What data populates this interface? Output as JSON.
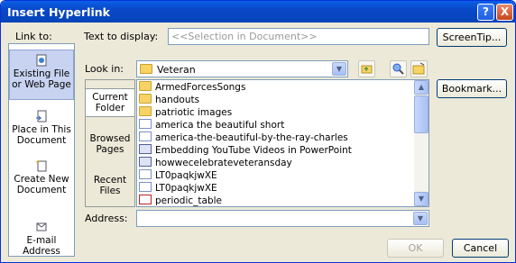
{
  "window": {
    "title": "Insert Hyperlink",
    "help": "?",
    "close": "X"
  },
  "link_to": {
    "label": "Link to:",
    "items": [
      {
        "label": "Existing File or Web Page"
      },
      {
        "label": "Place in This Document"
      },
      {
        "label": "Create New Document"
      },
      {
        "label": "E-mail Address"
      }
    ]
  },
  "text_to_display": {
    "label": "Text to display:",
    "value": "<<Selection in Document>>"
  },
  "screentip_label": "ScreenTip...",
  "look_in": {
    "label": "Look in:",
    "value": "Veteran"
  },
  "subnav": {
    "items": [
      {
        "label": "Current Folder"
      },
      {
        "label": "Browsed Pages"
      },
      {
        "label": "Recent Files"
      }
    ]
  },
  "bookmark_label": "Bookmark...",
  "files": [
    {
      "name": "ArmedForcesSongs",
      "icon": "folder-icon"
    },
    {
      "name": "handouts",
      "icon": "folder-icon"
    },
    {
      "name": "patriotic images",
      "icon": "folder-icon"
    },
    {
      "name": "america the beautiful short",
      "icon": "audio-file-icon"
    },
    {
      "name": "america-the-beautiful-by-the-ray-charles",
      "icon": "audio-file-icon"
    },
    {
      "name": "Embedding YouTube Videos in PowerPoint",
      "icon": "web-file-icon"
    },
    {
      "name": "howwecelebrateveteransday",
      "icon": "doc-file-icon"
    },
    {
      "name": "LT0paqkjwXE",
      "icon": "video-file-icon"
    },
    {
      "name": "LT0paqkjwXE",
      "icon": "video-file-icon"
    },
    {
      "name": "periodic_table",
      "icon": "pdf-file-icon"
    }
  ],
  "address": {
    "label": "Address:",
    "value": ""
  },
  "ok_label": "OK",
  "cancel_label": "Cancel"
}
